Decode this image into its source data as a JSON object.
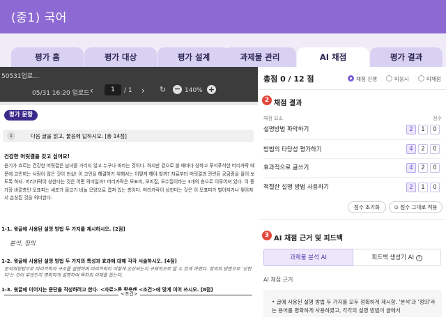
{
  "header": {
    "title": "(중1) 국어"
  },
  "tabs": [
    {
      "label": "평가 홈",
      "active": false
    },
    {
      "label": "평가 대상",
      "active": false
    },
    {
      "label": "평가 설계",
      "active": false
    },
    {
      "label": "과제물 관리",
      "active": false
    },
    {
      "label": "AI 채점",
      "active": true
    },
    {
      "label": "평가 결과",
      "active": false
    }
  ],
  "viewer": {
    "file_name": "50531업로…",
    "upload_date": "05/31 16:20 업로드",
    "prev_icon": "chevron-left-icon",
    "page_current": "1",
    "page_total": "/ 1",
    "next_icon": "chevron-right-icon",
    "zoom": "140%"
  },
  "paper": {
    "badge": "평가 문항",
    "question_number": "1",
    "question_text": "다음 글을 읽고, 물음에 답하시오. [총 14점]",
    "passage_heading": "건강한 머릿결을 갖고 싶어요!",
    "passage_body": "윤기가 흐르는 건강한 머릿결은 남녀를 가리지 않고 누구나 바라는 것이다. 하지만 겉으로 볼 때마다 상하고 푸석푸석한 머리카락 때문에 고민하는 사람이 많은 것이 현실! 이 고민을 해결하기 위해서는 어떻게 해야 할까? 자료부터 머릿결과 관련된 궁금증을 풀어 보도록 하자. 머리카락이 상한다는 것은 어떤 의미일까? 머리카락은 모표피, 모피질, 모수질이라는 3개의 층으로 이루어져 있다. 이 중 가장 바깥층인 모표피는 세포가 물고기 비늘 모양으로 겹쳐 있는 층이다. 머리카락이 상한다는 것은 이 모표피가 벌어지거나 찢어져서 손상된 것을 의미한다.",
    "q1_1": "1-1. 윗글에 사용된 설명 방법 두 가지를 제시하시오. [2점]",
    "a1_1": "분석, 정의",
    "q1_2": "1-2. 윗글에 사용된 설명 방법 두 가지의 특성과 효과에 대해 각각 서술하시오. [4점]",
    "a1_2": "분석의방법으로 머리카락의 구조를 설명하며 머리카락이 어떻게 손상되는지 구체적으로 알 수 있게 하였다. 정의의 방법으로 '상한다'는 것이 무엇인지 명확하게 설명하여 독자의 이해를 돕는다.",
    "q1_3": "1-3. 윗글에 이어지는 문단을 작성하려고 한다. <자료>를 활용해 <조건>에 맞게 이어 쓰시오. [8점]",
    "condition_label": "<조건>"
  },
  "panel": {
    "total": "총점 0 / 12 점",
    "radios": [
      {
        "label": "채점 진행",
        "checked": true
      },
      {
        "label": "미응시",
        "checked": false
      },
      {
        "label": "미채점",
        "checked": false
      }
    ],
    "section2": {
      "number": "2",
      "title": "채점 결과"
    },
    "col_criteria": "채점 요소",
    "col_score": "점수",
    "criteria": [
      {
        "label": "설명방법 파악하기",
        "scores": [
          "2",
          "1",
          "0"
        ]
      },
      {
        "label": "방법의 타당성 평가하기",
        "scores": [
          "4",
          "2",
          "0"
        ]
      },
      {
        "label": "효과적으로 글쓰기",
        "scores": [
          "4",
          "2",
          "0"
        ]
      },
      {
        "label": "적절한 설명 방법 사용하기",
        "scores": [
          "2",
          "1",
          "0"
        ]
      }
    ],
    "reset_label": "점수 초기화",
    "apply_label": "점수 그대로 적용",
    "section3": {
      "number": "3",
      "title": "AI 채점 근거 및 피드백"
    },
    "subtab_analysis": "과제물 분석 AI",
    "subtab_feedback": "피드백 생성기 AI",
    "ai_basis_label": "AI 채점 근거",
    "basis_text": "• 글에 사용된 설명 방법 두 가지를 모두 정확하게 제시함. '분석'과 '정의'라는 용어를 명확하게 사용하였고, 각각의 설명 방법이 글에서"
  },
  "colors": {
    "header": "#8d6ad3",
    "accent": "#7b5cd6",
    "section_badge": "#e2473c",
    "dark_badge": "#3d2b8c"
  }
}
